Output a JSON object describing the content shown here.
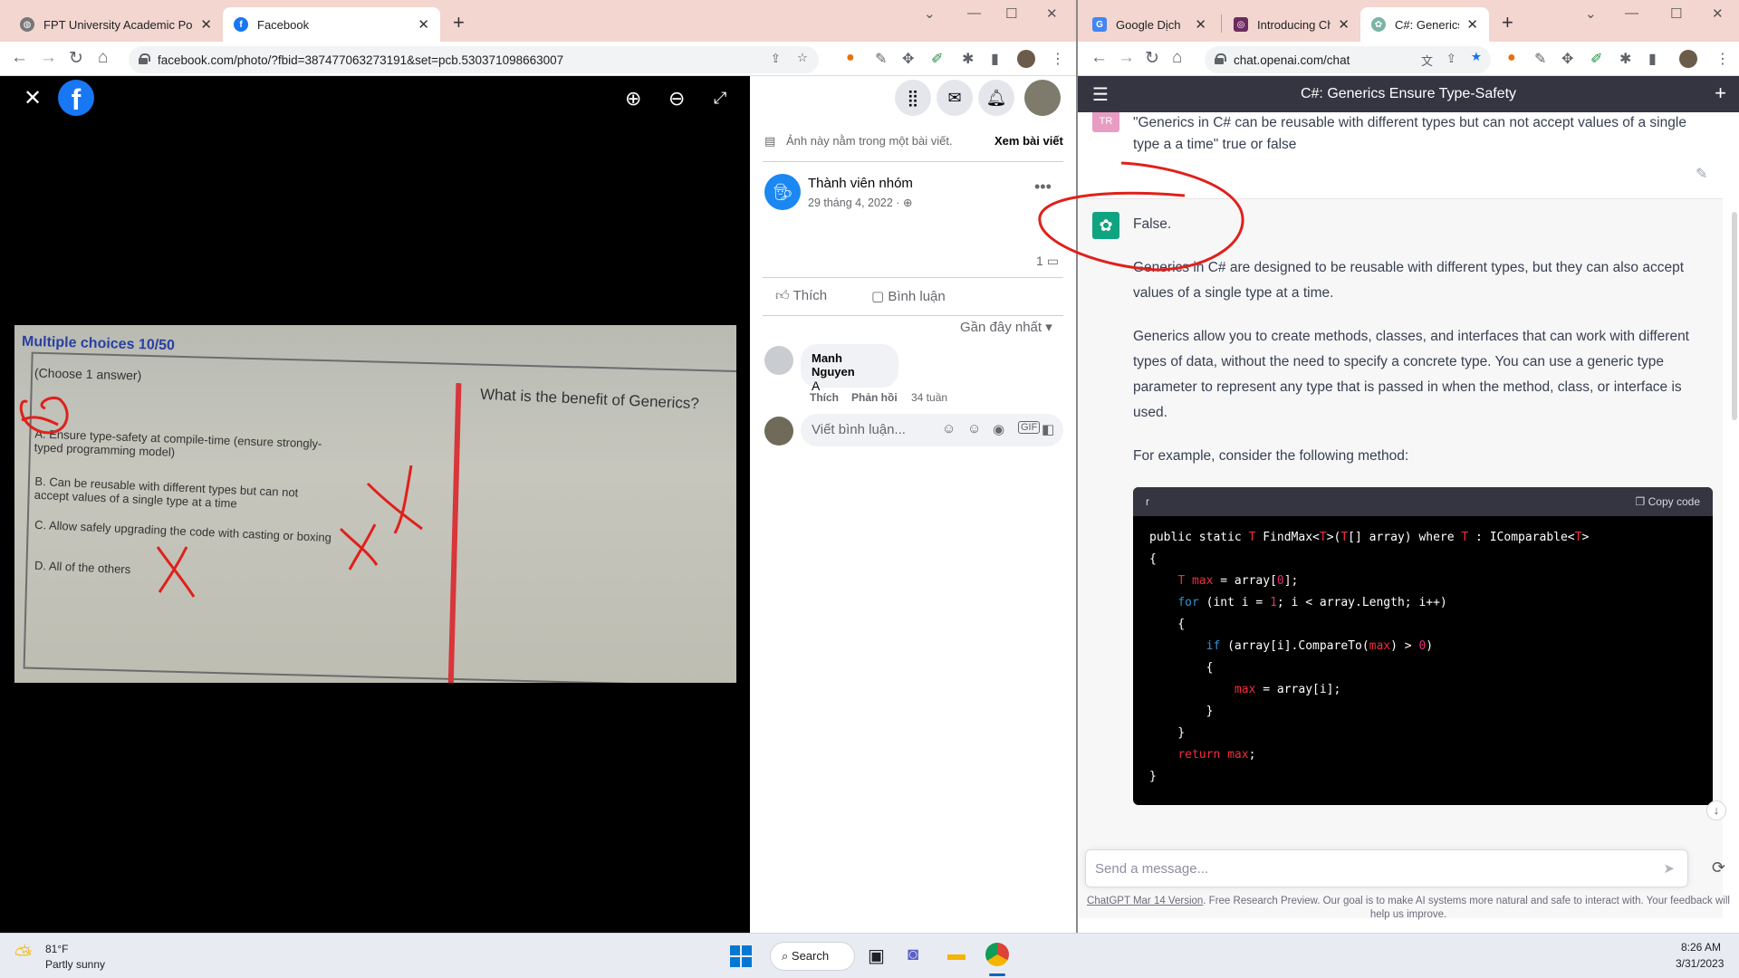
{
  "left_window": {
    "tabs": [
      {
        "title": "FPT University Academic Portal",
        "favicon": "globe-icon"
      },
      {
        "title": "Facebook",
        "favicon": "facebook-icon",
        "active": true
      }
    ],
    "url": "facebook.com/photo/?fbid=387477063273191&set=pcb.530371098663007"
  },
  "right_window": {
    "tabs": [
      {
        "title": "Google Dịch",
        "favicon": "google-translate-icon"
      },
      {
        "title": "Introducing Cha",
        "favicon": "openai-icon"
      },
      {
        "title": "C#: Generics En",
        "favicon": "chatgpt-icon",
        "active": true
      }
    ],
    "url": "chat.openai.com/chat"
  },
  "photo": {
    "heading": "Multiple choices 10/50",
    "instruction": "(Choose 1 answer)",
    "question": "What is the benefit of Generics?",
    "options": [
      {
        "letter": "A.",
        "text": "Ensure type-safety at compile-time (ensure strongly-typed programming model)"
      },
      {
        "letter": "B.",
        "text": "Can be reusable with different types but can not accept values of a single type at a time"
      },
      {
        "letter": "C.",
        "text": "Allow safely upgrading the code with casting or boxing"
      },
      {
        "letter": "D.",
        "text": "All of the others"
      }
    ]
  },
  "fb": {
    "notice": "Ảnh này nằm trong một bài viết.",
    "view_post": "Xem bài viết",
    "author": "Thành viên nhóm",
    "date": "29 tháng 4, 2022 · ",
    "comment_count": "1",
    "like": "Thích",
    "comment": "Bình luận",
    "sort": "Gần đây nhất",
    "comments": [
      {
        "author": "Manh Nguyen",
        "text": "A",
        "like": "Thích",
        "reply": "Phản hồi",
        "age": "34 tuần"
      }
    ],
    "write_placeholder": "Viết bình luận..."
  },
  "gpt": {
    "title": "C#: Generics Ensure Type-Safety",
    "user_initials": "TR",
    "user_msg": "\"Generics in C# can be reusable with different types but can not accept values of a single type a a time\" true or false",
    "answer_short": "False.",
    "para1": "Generics in C# are designed to be reusable with different types, but they can also accept values of a single type at a time.",
    "para2": "Generics allow you to create methods, classes, and interfaces that can work with different types of data, without the need to specify a concrete type. You can use a generic type parameter to represent any type that is passed in when the method, class, or interface is used.",
    "para3": "For example, consider the following method:",
    "code_lang": "r",
    "copy_label": "Copy code",
    "input_placeholder": "Send a message...",
    "footer_link": "ChatGPT Mar 14 Version",
    "footer_text": ". Free Research Preview. Our goal is to make AI systems more natural and safe to interact with. Your feedback will help us improve."
  },
  "taskbar": {
    "temp": "81°F",
    "weather": "Partly sunny",
    "search": "Search",
    "time": "8:26 AM",
    "date": "3/31/2023"
  },
  "colors": {
    "tab_bar": "#f3d6cf",
    "fb_blue": "#1877f2",
    "gpt_green": "#10a37f",
    "annotation_red": "#e0201b"
  }
}
